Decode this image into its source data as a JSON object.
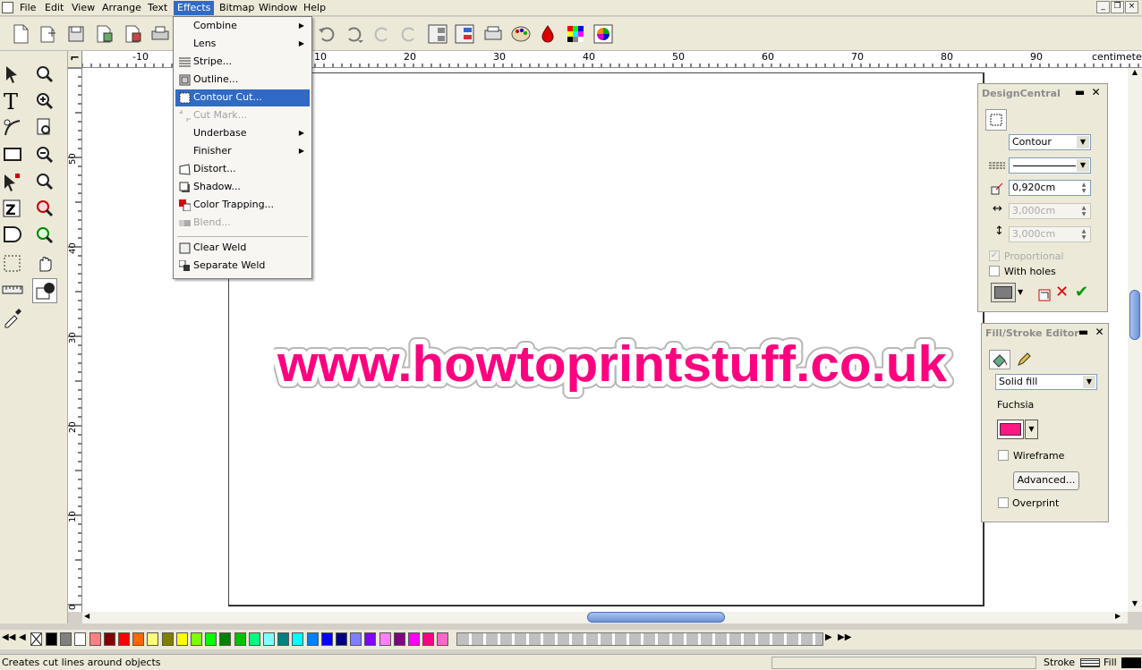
{
  "menubar": {
    "items": [
      "File",
      "Edit",
      "View",
      "Arrange",
      "Text",
      "Effects",
      "Bitmap",
      "Window",
      "Help"
    ],
    "active": "Effects"
  },
  "window_buttons": [
    "_",
    "❐",
    "×"
  ],
  "effects_menu": {
    "items": [
      {
        "label": "Combine",
        "submenu": true,
        "icon": "",
        "disabled": false,
        "highlighted": false
      },
      {
        "label": "Lens",
        "submenu": true,
        "icon": "",
        "disabled": false,
        "highlighted": false
      },
      {
        "label": "Stripe...",
        "submenu": false,
        "icon": "stripe-icon",
        "disabled": false,
        "highlighted": false
      },
      {
        "label": "Outline...",
        "submenu": false,
        "icon": "outline-icon",
        "disabled": false,
        "highlighted": false
      },
      {
        "label": "Contour Cut...",
        "submenu": false,
        "icon": "contour-cut-icon",
        "disabled": false,
        "highlighted": true
      },
      {
        "label": "Cut Mark...",
        "submenu": false,
        "icon": "cut-mark-icon",
        "disabled": true,
        "highlighted": false
      },
      {
        "label": "Underbase",
        "submenu": true,
        "icon": "",
        "disabled": false,
        "highlighted": false
      },
      {
        "label": "Finisher",
        "submenu": true,
        "icon": "",
        "disabled": false,
        "highlighted": false
      },
      {
        "label": "Distort...",
        "submenu": false,
        "icon": "distort-icon",
        "disabled": false,
        "highlighted": false
      },
      {
        "label": "Shadow...",
        "submenu": false,
        "icon": "shadow-icon",
        "disabled": false,
        "highlighted": false
      },
      {
        "label": "Color Trapping...",
        "submenu": false,
        "icon": "color-trapping-icon",
        "disabled": false,
        "highlighted": false
      },
      {
        "label": "Blend...",
        "submenu": false,
        "icon": "blend-icon",
        "disabled": true,
        "highlighted": false
      },
      {
        "label": "Clear Weld",
        "submenu": false,
        "icon": "clear-weld-icon",
        "disabled": false,
        "highlighted": false
      },
      {
        "label": "Separate Weld",
        "submenu": false,
        "icon": "separate-weld-icon",
        "disabled": false,
        "highlighted": false
      }
    ]
  },
  "rulers": {
    "horizontal_labels": [
      "-10",
      "10",
      "20",
      "30",
      "40",
      "50",
      "60",
      "70",
      "80",
      "90"
    ],
    "units": "centimeters",
    "vertical_labels": [
      "50",
      "40",
      "30",
      "20",
      "10",
      "0"
    ]
  },
  "canvas": {
    "logo_text": "www.howtoprintstuff.co.uk",
    "logo_color": "#ff007f"
  },
  "design_central": {
    "title": "DesignCentral",
    "mode": "Contour",
    "distance": "0,920cm",
    "width": "3,000cm",
    "height": "3,000cm",
    "proportional_label": "Proportional",
    "proportional_checked": true,
    "with_holes_label": "With holes",
    "with_holes_checked": false
  },
  "fill_stroke": {
    "title": "Fill/Stroke Editor",
    "fill_type": "Solid fill",
    "color_name": "Fuchsia",
    "color": "#ff1685",
    "wireframe_label": "Wireframe",
    "advanced_label": "Advanced...",
    "overprint_label": "Overprint"
  },
  "palette": {
    "colors": [
      "#000000",
      "#808080",
      "#ffffff",
      "#ff8080",
      "#800000",
      "#ff0000",
      "#ff6600",
      "#ffff80",
      "#808000",
      "#ffff00",
      "#80ff00",
      "#00ff00",
      "#008000",
      "#00c000",
      "#00ff80",
      "#80ffff",
      "#008080",
      "#00ffff",
      "#0080ff",
      "#0000ff",
      "#000080",
      "#8080ff",
      "#8000ff",
      "#ff80ff",
      "#800080",
      "#ff00ff",
      "#ff0080",
      "#ff66cc"
    ]
  },
  "status": {
    "message": "Creates cut lines around objects",
    "stroke_label": "Stroke",
    "fill_label": "Fill"
  }
}
